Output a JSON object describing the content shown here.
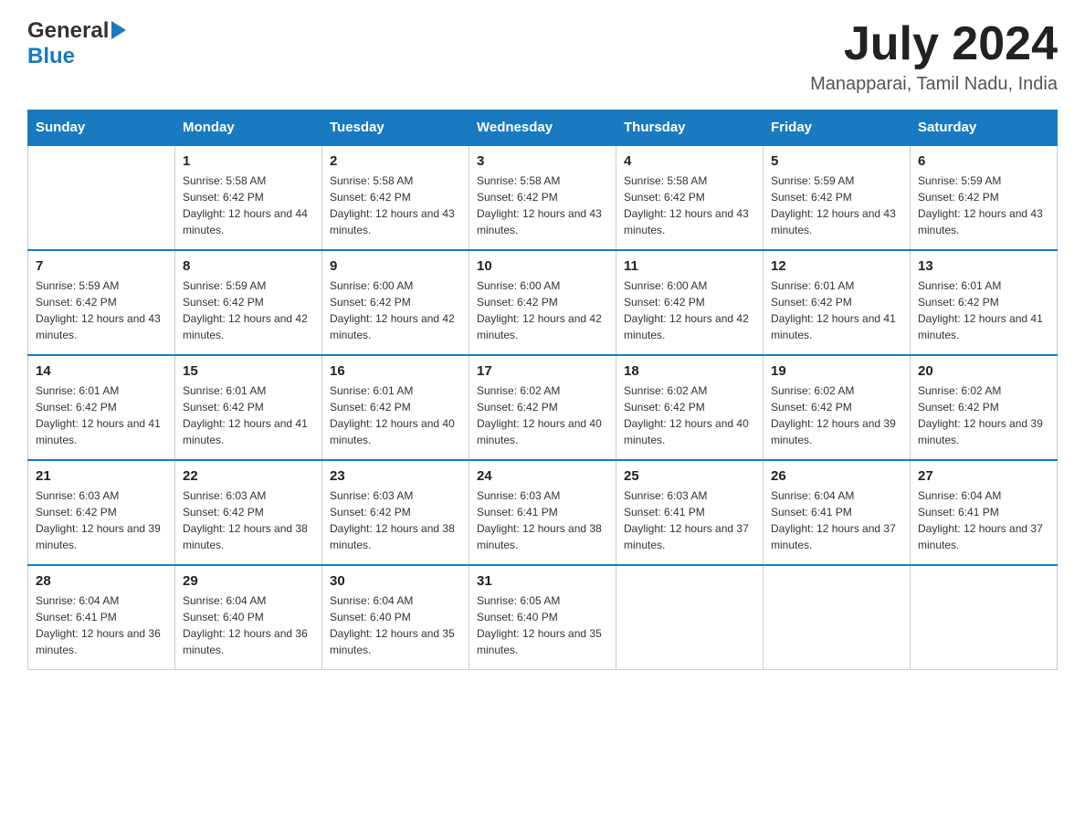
{
  "header": {
    "logo_general": "General",
    "logo_blue": "Blue",
    "month_title": "July 2024",
    "location": "Manapparai, Tamil Nadu, India"
  },
  "weekdays": [
    "Sunday",
    "Monday",
    "Tuesday",
    "Wednesday",
    "Thursday",
    "Friday",
    "Saturday"
  ],
  "weeks": [
    [
      {
        "day": "",
        "sunrise": "",
        "sunset": "",
        "daylight": ""
      },
      {
        "day": "1",
        "sunrise": "Sunrise: 5:58 AM",
        "sunset": "Sunset: 6:42 PM",
        "daylight": "Daylight: 12 hours and 44 minutes."
      },
      {
        "day": "2",
        "sunrise": "Sunrise: 5:58 AM",
        "sunset": "Sunset: 6:42 PM",
        "daylight": "Daylight: 12 hours and 43 minutes."
      },
      {
        "day": "3",
        "sunrise": "Sunrise: 5:58 AM",
        "sunset": "Sunset: 6:42 PM",
        "daylight": "Daylight: 12 hours and 43 minutes."
      },
      {
        "day": "4",
        "sunrise": "Sunrise: 5:58 AM",
        "sunset": "Sunset: 6:42 PM",
        "daylight": "Daylight: 12 hours and 43 minutes."
      },
      {
        "day": "5",
        "sunrise": "Sunrise: 5:59 AM",
        "sunset": "Sunset: 6:42 PM",
        "daylight": "Daylight: 12 hours and 43 minutes."
      },
      {
        "day": "6",
        "sunrise": "Sunrise: 5:59 AM",
        "sunset": "Sunset: 6:42 PM",
        "daylight": "Daylight: 12 hours and 43 minutes."
      }
    ],
    [
      {
        "day": "7",
        "sunrise": "Sunrise: 5:59 AM",
        "sunset": "Sunset: 6:42 PM",
        "daylight": "Daylight: 12 hours and 43 minutes."
      },
      {
        "day": "8",
        "sunrise": "Sunrise: 5:59 AM",
        "sunset": "Sunset: 6:42 PM",
        "daylight": "Daylight: 12 hours and 42 minutes."
      },
      {
        "day": "9",
        "sunrise": "Sunrise: 6:00 AM",
        "sunset": "Sunset: 6:42 PM",
        "daylight": "Daylight: 12 hours and 42 minutes."
      },
      {
        "day": "10",
        "sunrise": "Sunrise: 6:00 AM",
        "sunset": "Sunset: 6:42 PM",
        "daylight": "Daylight: 12 hours and 42 minutes."
      },
      {
        "day": "11",
        "sunrise": "Sunrise: 6:00 AM",
        "sunset": "Sunset: 6:42 PM",
        "daylight": "Daylight: 12 hours and 42 minutes."
      },
      {
        "day": "12",
        "sunrise": "Sunrise: 6:01 AM",
        "sunset": "Sunset: 6:42 PM",
        "daylight": "Daylight: 12 hours and 41 minutes."
      },
      {
        "day": "13",
        "sunrise": "Sunrise: 6:01 AM",
        "sunset": "Sunset: 6:42 PM",
        "daylight": "Daylight: 12 hours and 41 minutes."
      }
    ],
    [
      {
        "day": "14",
        "sunrise": "Sunrise: 6:01 AM",
        "sunset": "Sunset: 6:42 PM",
        "daylight": "Daylight: 12 hours and 41 minutes."
      },
      {
        "day": "15",
        "sunrise": "Sunrise: 6:01 AM",
        "sunset": "Sunset: 6:42 PM",
        "daylight": "Daylight: 12 hours and 41 minutes."
      },
      {
        "day": "16",
        "sunrise": "Sunrise: 6:01 AM",
        "sunset": "Sunset: 6:42 PM",
        "daylight": "Daylight: 12 hours and 40 minutes."
      },
      {
        "day": "17",
        "sunrise": "Sunrise: 6:02 AM",
        "sunset": "Sunset: 6:42 PM",
        "daylight": "Daylight: 12 hours and 40 minutes."
      },
      {
        "day": "18",
        "sunrise": "Sunrise: 6:02 AM",
        "sunset": "Sunset: 6:42 PM",
        "daylight": "Daylight: 12 hours and 40 minutes."
      },
      {
        "day": "19",
        "sunrise": "Sunrise: 6:02 AM",
        "sunset": "Sunset: 6:42 PM",
        "daylight": "Daylight: 12 hours and 39 minutes."
      },
      {
        "day": "20",
        "sunrise": "Sunrise: 6:02 AM",
        "sunset": "Sunset: 6:42 PM",
        "daylight": "Daylight: 12 hours and 39 minutes."
      }
    ],
    [
      {
        "day": "21",
        "sunrise": "Sunrise: 6:03 AM",
        "sunset": "Sunset: 6:42 PM",
        "daylight": "Daylight: 12 hours and 39 minutes."
      },
      {
        "day": "22",
        "sunrise": "Sunrise: 6:03 AM",
        "sunset": "Sunset: 6:42 PM",
        "daylight": "Daylight: 12 hours and 38 minutes."
      },
      {
        "day": "23",
        "sunrise": "Sunrise: 6:03 AM",
        "sunset": "Sunset: 6:42 PM",
        "daylight": "Daylight: 12 hours and 38 minutes."
      },
      {
        "day": "24",
        "sunrise": "Sunrise: 6:03 AM",
        "sunset": "Sunset: 6:41 PM",
        "daylight": "Daylight: 12 hours and 38 minutes."
      },
      {
        "day": "25",
        "sunrise": "Sunrise: 6:03 AM",
        "sunset": "Sunset: 6:41 PM",
        "daylight": "Daylight: 12 hours and 37 minutes."
      },
      {
        "day": "26",
        "sunrise": "Sunrise: 6:04 AM",
        "sunset": "Sunset: 6:41 PM",
        "daylight": "Daylight: 12 hours and 37 minutes."
      },
      {
        "day": "27",
        "sunrise": "Sunrise: 6:04 AM",
        "sunset": "Sunset: 6:41 PM",
        "daylight": "Daylight: 12 hours and 37 minutes."
      }
    ],
    [
      {
        "day": "28",
        "sunrise": "Sunrise: 6:04 AM",
        "sunset": "Sunset: 6:41 PM",
        "daylight": "Daylight: 12 hours and 36 minutes."
      },
      {
        "day": "29",
        "sunrise": "Sunrise: 6:04 AM",
        "sunset": "Sunset: 6:40 PM",
        "daylight": "Daylight: 12 hours and 36 minutes."
      },
      {
        "day": "30",
        "sunrise": "Sunrise: 6:04 AM",
        "sunset": "Sunset: 6:40 PM",
        "daylight": "Daylight: 12 hours and 35 minutes."
      },
      {
        "day": "31",
        "sunrise": "Sunrise: 6:05 AM",
        "sunset": "Sunset: 6:40 PM",
        "daylight": "Daylight: 12 hours and 35 minutes."
      },
      {
        "day": "",
        "sunrise": "",
        "sunset": "",
        "daylight": ""
      },
      {
        "day": "",
        "sunrise": "",
        "sunset": "",
        "daylight": ""
      },
      {
        "day": "",
        "sunrise": "",
        "sunset": "",
        "daylight": ""
      }
    ]
  ]
}
